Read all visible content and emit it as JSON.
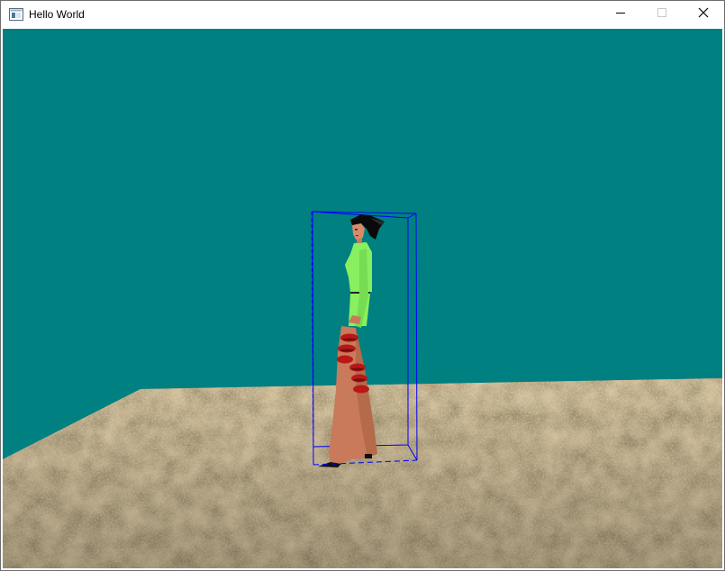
{
  "window": {
    "title": "Hello World",
    "controls": {
      "minimize_icon": "minimize-icon",
      "maximize_icon": "maximize-icon",
      "close_icon": "close-icon"
    }
  },
  "scene": {
    "sky_color": "#008080",
    "ground_color": "#8a7450",
    "bounding_box_color": "#0000ff",
    "character": {
      "hair_color": "#0a0a0a",
      "top_color": "#88f060",
      "skin_color": "#c87a5a",
      "band_color": "#b81818"
    }
  }
}
